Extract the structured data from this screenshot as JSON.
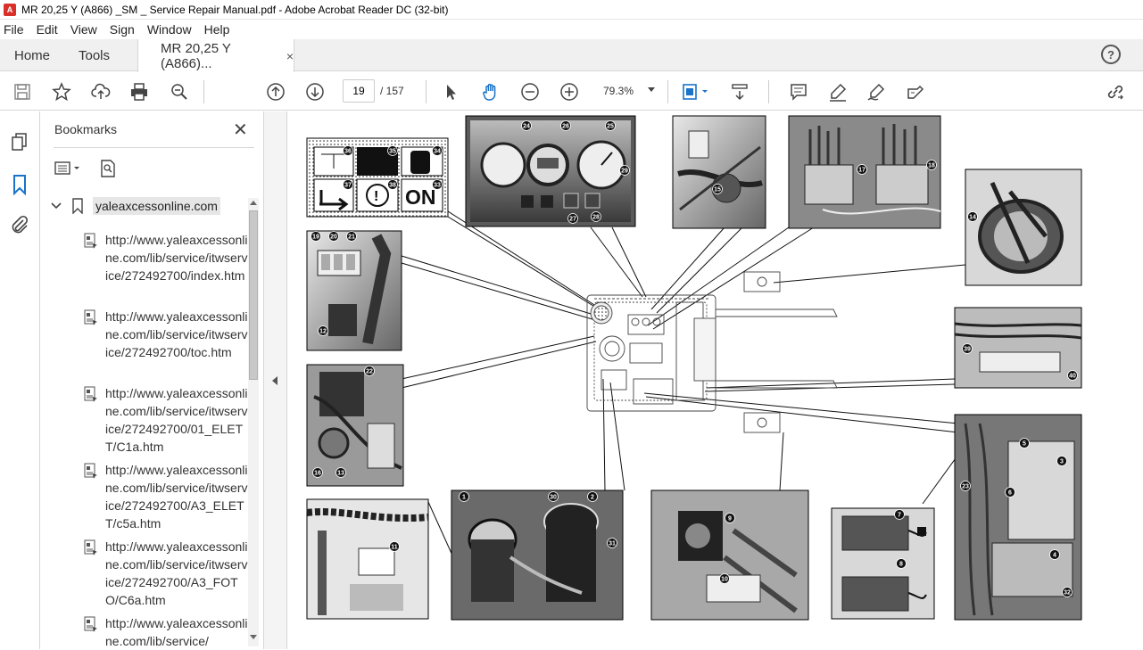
{
  "window": {
    "title": "MR 20,25 Y (A866) _SM _ Service Repair Manual.pdf - Adobe Acrobat Reader DC (32-bit)",
    "app_icon": "pdf-icon"
  },
  "menu": [
    "File",
    "Edit",
    "View",
    "Sign",
    "Window",
    "Help"
  ],
  "tabs": {
    "home": "Home",
    "tools": "Tools",
    "document": "MR 20,25 Y (A866)...",
    "close": "×"
  },
  "help": "?",
  "toolbar": {
    "page_current": "19",
    "page_total": "/ 157",
    "zoom": "79.3%"
  },
  "bookmarks": {
    "title": "Bookmarks",
    "close": "✕",
    "root": "yaleaxcessonline.com",
    "items": [
      "http://www.yaleaxcessonline.com/lib/service/itwservice/272492700/index.htm",
      "http://www.yaleaxcessonline.com/lib/service/itwservice/272492700/toc.htm",
      "http://www.yaleaxcessonline.com/lib/service/itwservice/272492700/01_ELETT/C1a.htm",
      "http://www.yaleaxcessonline.com/lib/service/itwservice/272492700/A3_ELETT/c5a.htm",
      "http://www.yaleaxcessonline.com/lib/service/itwservice/272492700/A3_FOTO/C6a.htm",
      "http://www.yaleaxcessonline.com/lib/service/"
    ]
  },
  "diagram": {
    "decal_labels": [
      "ON"
    ],
    "callouts": [
      "1",
      "2",
      "3",
      "4",
      "5",
      "6",
      "7",
      "8",
      "9",
      "10",
      "11",
      "12",
      "13",
      "14",
      "15",
      "16",
      "17",
      "18",
      "19",
      "20",
      "21",
      "22",
      "23",
      "24",
      "25",
      "26",
      "27",
      "28",
      "29",
      "30",
      "31",
      "32",
      "33",
      "34",
      "35",
      "36",
      "37",
      "38",
      "39",
      "40"
    ]
  }
}
